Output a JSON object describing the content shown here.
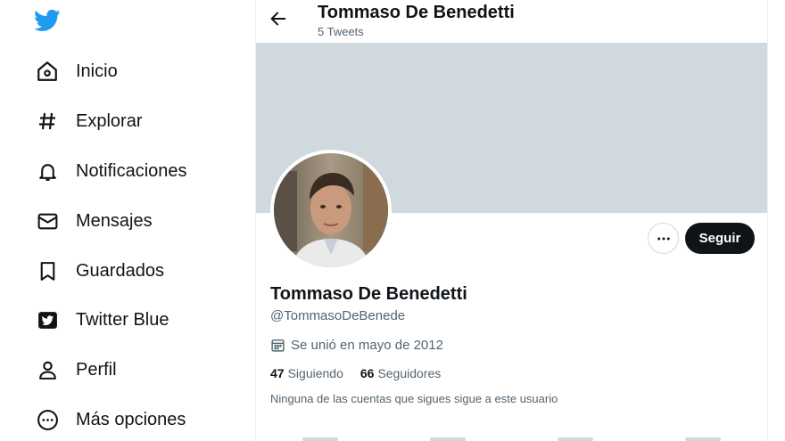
{
  "sidebar": {
    "items": [
      {
        "label": "Inicio",
        "icon": "home-icon"
      },
      {
        "label": "Explorar",
        "icon": "hashtag-icon"
      },
      {
        "label": "Notificaciones",
        "icon": "bell-icon"
      },
      {
        "label": "Mensajes",
        "icon": "envelope-icon"
      },
      {
        "label": "Guardados",
        "icon": "bookmark-icon"
      },
      {
        "label": "Twitter Blue",
        "icon": "twitter-blue-icon"
      },
      {
        "label": "Perfil",
        "icon": "person-icon"
      },
      {
        "label": "Más opciones",
        "icon": "more-circle-icon"
      }
    ]
  },
  "header": {
    "name": "Tommaso De Benedetti",
    "tweet_count": "5 Tweets"
  },
  "profile": {
    "name": "Tommaso De Benedetti",
    "handle": "@TommasoDeBenede",
    "joined": "Se unió en mayo de 2012",
    "following_count": "47",
    "following_label": "Siguiendo",
    "followers_count": "66",
    "followers_label": "Seguidores",
    "note": "Ninguna de las cuentas que sigues sigue a este usuario"
  },
  "actions": {
    "follow_label": "Seguir"
  },
  "colors": {
    "brand": "#1d9bf0",
    "banner": "#cfd9de",
    "text": "#0f1419",
    "muted": "#536471"
  }
}
